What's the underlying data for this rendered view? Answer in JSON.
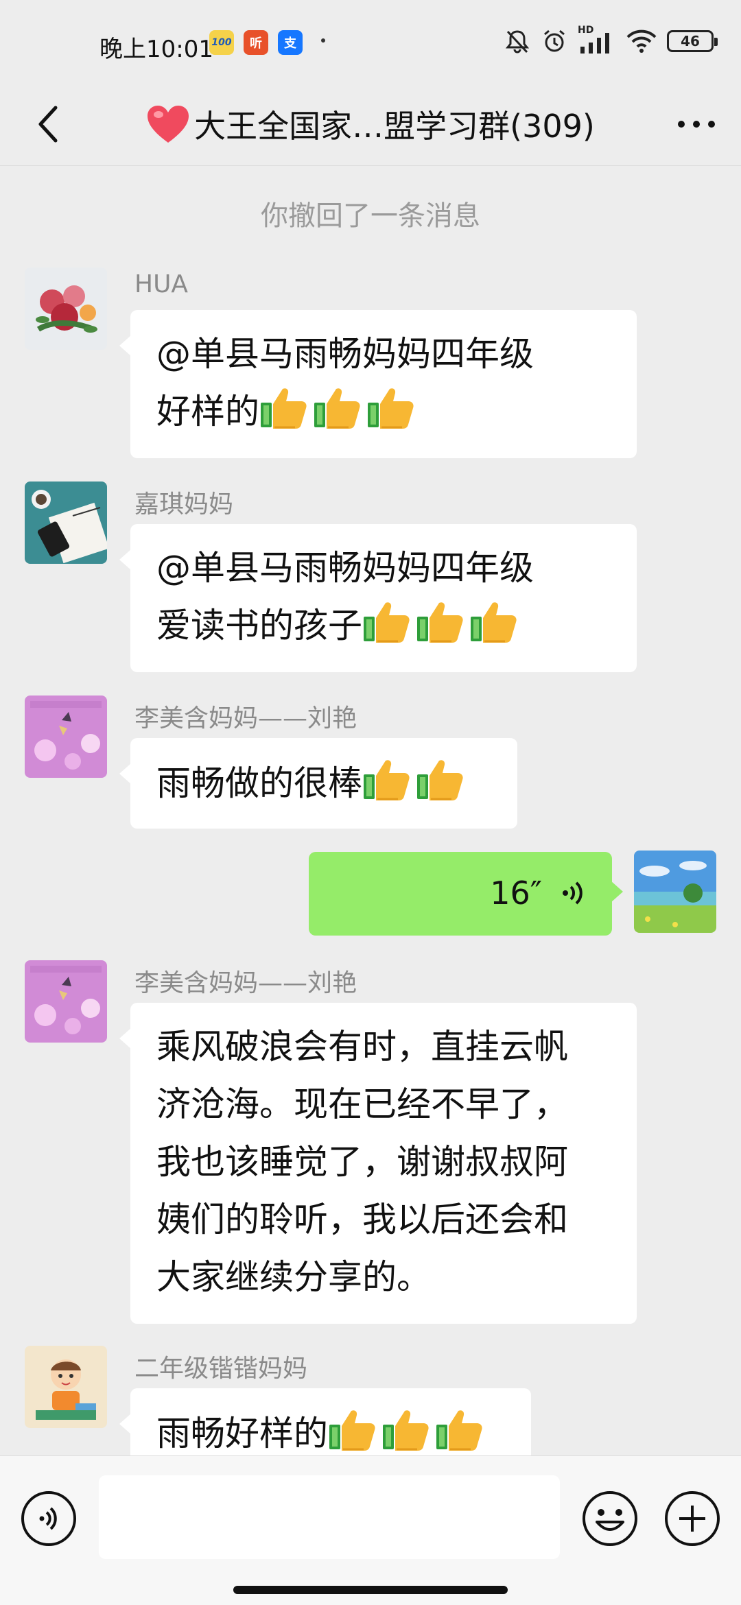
{
  "status_bar": {
    "time": "晚上10:01",
    "app_icons": [
      "100-app-icon",
      "ting-app-icon",
      "alipay-app-icon"
    ],
    "network_label": "HD",
    "battery": "46"
  },
  "header": {
    "title": "大王全国家…盟学习群(309)",
    "title_prefix_icon": "red-heart-icon"
  },
  "chat": {
    "system_message": "你撤回了一条消息",
    "messages": [
      {
        "sender": "HUA",
        "line1": "@单县马雨畅妈妈四年级",
        "line2": "好样的",
        "thumbs": 3
      },
      {
        "sender": "嘉琪妈妈",
        "line1": "@单县马雨畅妈妈四年级",
        "line2": "爱读书的孩子",
        "thumbs": 3
      },
      {
        "sender": "李美含妈妈——刘艳",
        "line1": "雨畅做的很棒",
        "thumbs": 2
      },
      {
        "self_voice": "16″"
      },
      {
        "sender": "李美含妈妈——刘艳",
        "lines": [
          "乘风破浪会有时，直挂云帆",
          "济沧海。现在已经不早了，",
          "我也该睡觉了，谢谢叔叔阿",
          "姨们的聆听，我以后还会和",
          "大家继续分享的。"
        ]
      },
      {
        "sender": "二年级锴锴妈妈",
        "line1": "雨畅好样的",
        "thumbs": 3
      }
    ]
  },
  "input_bar": {
    "placeholder": ""
  },
  "colors": {
    "background": "#ededed",
    "self_bubble": "#95ec69",
    "other_bubble": "#ffffff"
  }
}
